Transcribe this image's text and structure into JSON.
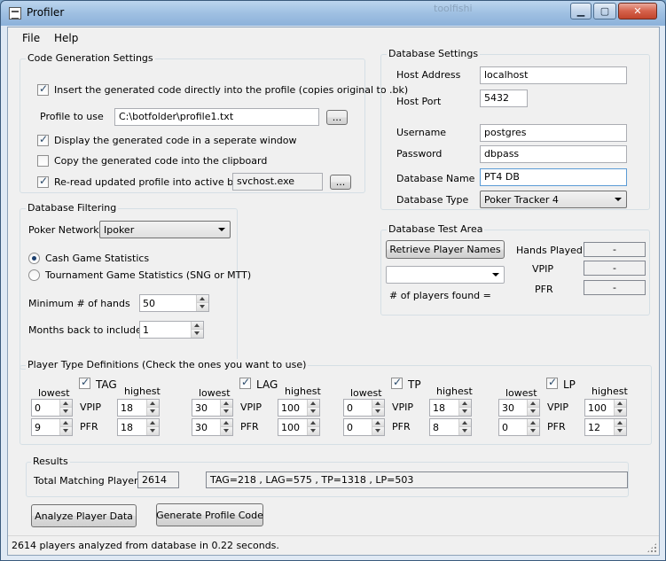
{
  "window": {
    "title": "Profiler",
    "background_tab_title": "toolfishi"
  },
  "menu": [
    "File",
    "Help"
  ],
  "code_gen": {
    "legend": "Code Generation Settings",
    "insert_label": "Insert the generated code directly into the profile (copies original to .bk)",
    "insert_checked": true,
    "profile_label": "Profile to use",
    "profile_value": "C:\\botfolder\\profile1.txt",
    "browse_label": "...",
    "display_label": "Display the generated code in a seperate window",
    "display_checked": true,
    "clipboard_label": "Copy the generated code into the clipboard",
    "clipboard_checked": false,
    "reread_label": "Re-read updated profile into active bots",
    "reread_checked": true,
    "process_value": "svchost.exe",
    "process_browse_label": "..."
  },
  "db_settings": {
    "legend": "Database Settings",
    "host_label": "Host Address",
    "host_value": "localhost",
    "port_label": "Host Port",
    "port_value": "5432",
    "user_label": "Username",
    "user_value": "postgres",
    "pass_label": "Password",
    "pass_value": "dbpass",
    "dbname_label": "Database Name",
    "dbname_value": "PT4 DB",
    "dbtype_label": "Database Type",
    "dbtype_value": "Poker Tracker 4"
  },
  "db_filter": {
    "legend": "Database Filtering",
    "network_label": "Poker Network",
    "network_value": "Ipoker",
    "cash_label": "Cash Game Statistics",
    "tourney_label": "Tournament Game Statistics (SNG or MTT)",
    "selected": "cash",
    "min_hands_label": "Minimum # of hands",
    "min_hands_value": "50",
    "months_label": "Months back to include",
    "months_value": "1"
  },
  "db_test": {
    "legend": "Database Test Area",
    "retrieve_label": "Retrieve Player Names",
    "players_found_label": "# of players found =",
    "hands_played_label": "Hands Played",
    "hands_played_value": "-",
    "vpip_label": "VPIP",
    "vpip_value": "-",
    "pfr_label": "PFR",
    "pfr_value": "-"
  },
  "player_types": {
    "legend": "Player Type Definitions (Check the ones you want to use)",
    "lowest_label": "lowest",
    "highest_label": "highest",
    "vpip_label": "VPIP",
    "pfr_label": "PFR",
    "types": [
      {
        "name": "TAG",
        "checked": true,
        "vpip_low": "0",
        "vpip_high": "18",
        "pfr_low": "9",
        "pfr_high": "18"
      },
      {
        "name": "LAG",
        "checked": true,
        "vpip_low": "30",
        "vpip_high": "100",
        "pfr_low": "30",
        "pfr_high": "100"
      },
      {
        "name": "TP",
        "checked": true,
        "vpip_low": "0",
        "vpip_high": "18",
        "pfr_low": "0",
        "pfr_high": "8"
      },
      {
        "name": "LP",
        "checked": true,
        "vpip_low": "30",
        "vpip_high": "100",
        "pfr_low": "0",
        "pfr_high": "12"
      }
    ]
  },
  "results": {
    "legend": "Results",
    "total_label": "Total Matching Players",
    "total_value": "2614",
    "summary_value": "TAG=218 , LAG=575 , TP=1318 , LP=503"
  },
  "actions": {
    "analyze_label": "Analyze Player Data",
    "generate_label": "Generate Profile Code"
  },
  "status": {
    "text": "2614 players analyzed from database in 0.22 seconds."
  }
}
